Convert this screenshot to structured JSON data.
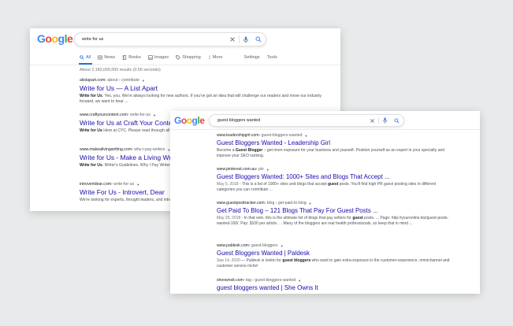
{
  "back": {
    "logo": [
      "G",
      "o",
      "o",
      "g",
      "l",
      "e"
    ],
    "query": "write for us",
    "tabs": [
      {
        "label": "All",
        "icon": "search-icon"
      },
      {
        "label": "News",
        "icon": "news-icon"
      },
      {
        "label": "Books",
        "icon": "book-icon"
      },
      {
        "label": "Images",
        "icon": "image-icon"
      },
      {
        "label": "Shopping",
        "icon": "tag-icon"
      },
      {
        "label": "More",
        "icon": "more-dots-icon"
      }
    ],
    "settings": "Settings",
    "tools": "Tools",
    "stats": "About 2,180,000,000 results (0.56 seconds)",
    "results": [
      {
        "site": "alistapart.com",
        "crumb": " › about › contribute",
        "title": "Write for Us — A List Apart",
        "snippet_bold": "Write for Us",
        "snippet": ". Yes, you. We're always looking for new authors. If you've got an idea that will challenge our readers and move our industry forward, we want to hear ..."
      },
      {
        "site": "www.craftyourcontent.com",
        "crumb": " › write-for-us",
        "title": "Write for Us at Craft Your Content",
        "snippet_bold": "Write for Us",
        "snippet": " Here at CYC. Please read through all the guidelines. I h... less than a better chance of acceptance. Before hitting ..."
      },
      {
        "site": "www.makealivingwriting.com",
        "crumb": " › why-i-pay-writers",
        "title": "Write for Us - Make a Living Writing",
        "snippet_bold": "Write for Us",
        "snippet": ". Writer's Guidelines. Why I Pay Writers. F... for Guest Posts."
      },
      {
        "site": "introvertdear.com",
        "crumb": " › write-for-us",
        "title": "Write For Us - Introvert, Dear",
        "snippet_bold": "",
        "snippet": "We're looking for experts, thought leaders, and introve... write for Introvert, Dear? Calling all highly sensitive p..."
      }
    ]
  },
  "front": {
    "logo": [
      "G",
      "o",
      "o",
      "g",
      "l",
      "e"
    ],
    "query": "guest bloggers wanted",
    "results": [
      {
        "site": "www.leadershipgirl.com",
        "crumb": " › guest-bloggers-wanted",
        "title": "Guest Bloggers Wanted - Leadership Girl",
        "date": "",
        "snippet_pre": "Become a ",
        "snippet_bold": "Guest Blogger",
        "snippet": " – get more exposure for your business and yourself. Position yourself as an expert in your specialty and improve your SEO ranking."
      },
      {
        "site": "www.pinterest.com.au",
        "crumb": " › pin",
        "title": "Guest Bloggers Wanted: 1000+ Sites and Blogs That Accept ...",
        "date": "May 5, 2018",
        "snippet_pre": " - This is a list of 1000+ sites and blogs that accept ",
        "snippet_bold": "guest",
        "snippet": " posts. You'll find high PR guest posting sites in different categories you can contribute ..."
      },
      {
        "site": "www.guestposttracker.com",
        "crumb": " › blog › get-paid-to-blog",
        "title": "Get Paid To Blog – 121 Blogs That Pay For Guest Posts ...",
        "date": "May 25, 2018",
        "snippet_pre": " - In that vein, this is the ultimate list of blogs that pay writers for ",
        "snippet_bold": "guest",
        "snippet": " posts. ... Page: http://youronline.biz/guest-posts-wanted-100/. Pay: $100 per article. ... Many of the bloggers are real health professionals, so keep that in mind ..."
      },
      {
        "site": "www.paldesk.com",
        "crumb": " › guest-bloggers",
        "title": "Guest Bloggers Wanted | Paldesk",
        "date": "Sep 14, 2020",
        "snippet_pre": " — Paldesk is lookin for ",
        "snippet_bold": "guest bloggers",
        "snippet": " who want to gain extra-exposure in the customer-experience, omnichannel and customer service niche!"
      },
      {
        "site": "sheownsit.com",
        "crumb": " › tag › guest-bloggers-wanted",
        "title": "guest bloggers wanted | She Owns It",
        "date": "",
        "snippet_pre": "",
        "snippet_bold": "",
        "snippet": ""
      }
    ]
  },
  "colors": {
    "link": "#1a0dab",
    "accent": "#1a73e8",
    "mic_blue": "#4285f4",
    "background": "#e9eaeb"
  }
}
